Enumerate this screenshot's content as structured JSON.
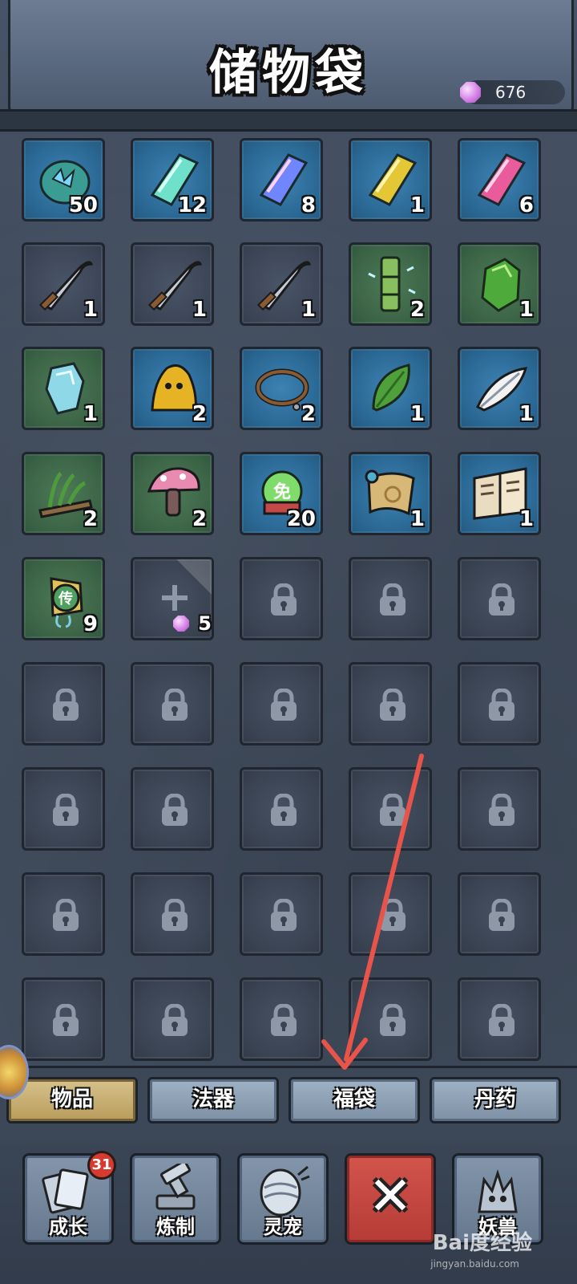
{
  "header": {
    "title": "储物袋",
    "currency_value": "676",
    "currency_icon": "purple-gem-icon"
  },
  "grid": {
    "rows": [
      [
        {
          "icon": "blue-spirit-stone-icon",
          "rarity": "blue",
          "count": "50"
        },
        {
          "icon": "cyan-crystal-icon",
          "rarity": "blue",
          "count": "12"
        },
        {
          "icon": "blue-crystal-icon",
          "rarity": "blue",
          "count": "8"
        },
        {
          "icon": "gold-crystal-icon",
          "rarity": "blue",
          "count": "1"
        },
        {
          "icon": "pink-crystal-icon",
          "rarity": "blue",
          "count": "6"
        }
      ],
      [
        {
          "icon": "sickle-blade-icon",
          "rarity": "gray",
          "count": "1"
        },
        {
          "icon": "sickle-blade-icon",
          "rarity": "gray",
          "count": "1"
        },
        {
          "icon": "sickle-blade-icon",
          "rarity": "gray",
          "count": "1"
        },
        {
          "icon": "bamboo-icon",
          "rarity": "green",
          "count": "2"
        },
        {
          "icon": "green-ore-icon",
          "rarity": "green",
          "count": "1"
        }
      ],
      [
        {
          "icon": "ice-crystal-icon",
          "rarity": "green",
          "count": "1"
        },
        {
          "icon": "golden-slime-icon",
          "rarity": "blue",
          "count": "2"
        },
        {
          "icon": "rope-coil-icon",
          "rarity": "blue",
          "count": "2"
        },
        {
          "icon": "green-leaf-icon",
          "rarity": "blue",
          "count": "1"
        },
        {
          "icon": "white-feather-icon",
          "rarity": "blue",
          "count": "1"
        }
      ],
      [
        {
          "icon": "herb-bundle-icon",
          "rarity": "green",
          "count": "2"
        },
        {
          "icon": "pink-mushroom-icon",
          "rarity": "green",
          "count": "2"
        },
        {
          "icon": "exemption-token-icon",
          "rarity": "blue",
          "count": "20",
          "label": "免"
        },
        {
          "icon": "scroll-icon",
          "rarity": "blue",
          "count": "1"
        },
        {
          "icon": "open-book-icon",
          "rarity": "blue",
          "count": "1"
        }
      ],
      [
        {
          "icon": "transmission-jade-icon",
          "rarity": "green",
          "count": "9",
          "label": "传"
        },
        {
          "icon": "plus-icon",
          "rarity": "expand",
          "count": "5"
        },
        {
          "icon": "lock-icon",
          "rarity": "locked"
        },
        {
          "icon": "lock-icon",
          "rarity": "locked"
        },
        {
          "icon": "lock-icon",
          "rarity": "locked"
        }
      ]
    ],
    "locked_rows": 4
  },
  "tabs": [
    {
      "label": "物品",
      "active": true
    },
    {
      "label": "法器",
      "active": false
    },
    {
      "label": "福袋",
      "active": false
    },
    {
      "label": "丹药",
      "active": false
    }
  ],
  "nav": [
    {
      "label": "成长",
      "icon": "growth-cards-icon",
      "badge": "31"
    },
    {
      "label": "炼制",
      "icon": "forge-hammer-icon"
    },
    {
      "label": "灵宠",
      "icon": "spirit-pet-egg-icon"
    },
    {
      "label": "",
      "icon": "close-icon"
    },
    {
      "label": "妖兽",
      "icon": "demon-beast-icon"
    }
  ],
  "watermark": {
    "text": "Bai度经验",
    "url": "jingyan.baidu.com"
  },
  "colors": {
    "blue_slot": "#2a6793",
    "green_slot": "#3b6446",
    "gray_slot": "#3c4657",
    "active_tab": "#c9b072",
    "close_button": "#c44740",
    "annotation_arrow": "#e8534a"
  }
}
